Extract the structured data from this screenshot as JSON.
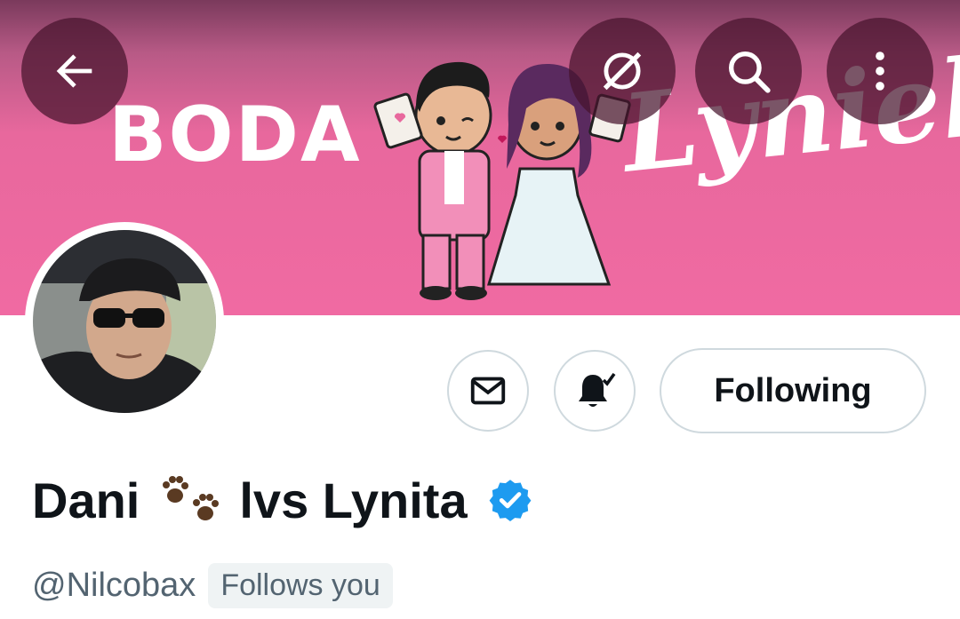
{
  "banner": {
    "left_text": "BODA",
    "right_text": "Lyniel"
  },
  "top_bar": {
    "back_icon": "arrow-left-icon",
    "grok_icon": "slashed-circle-icon",
    "search_icon": "search-icon",
    "more_icon": "more-vertical-icon"
  },
  "actions": {
    "message_icon": "envelope-icon",
    "notifications_icon": "bell-check-icon",
    "following_label": "Following"
  },
  "profile": {
    "name_part1": "Dani",
    "name_emoji": "🐾",
    "name_part2": "lvs Lynita",
    "verified_icon": "verified-badge-icon",
    "handle": "@Nilcobax",
    "follows_you": "Follows you"
  },
  "colors": {
    "banner_pink": "#f06aa2",
    "verified_blue": "#1d9bf0",
    "muted_text": "#536471",
    "border": "#cfd9de"
  }
}
